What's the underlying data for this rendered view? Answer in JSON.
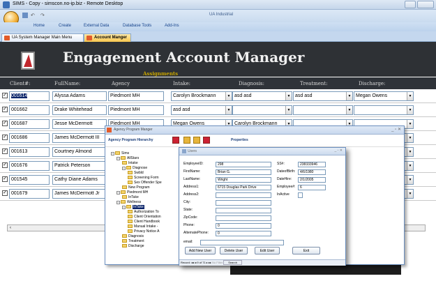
{
  "window": {
    "title": "SIMS - Copy - simscon.no-ip.biz - Remote Desktop",
    "app_title": "UA Industrial"
  },
  "ribbon": {
    "tabs": [
      "Home",
      "Create",
      "External Data",
      "Database Tools",
      "Add-Ins"
    ]
  },
  "doc_tabs": [
    "UA System Manager Main Menu",
    "Account Manger"
  ],
  "header": {
    "title": "Engagement Account Manager",
    "subtitle": "Assignments"
  },
  "columns": [
    "Client#:",
    "FullName:",
    "Agency",
    "Intake:",
    "Diagnosis:",
    "Treatment:",
    "Discharge:"
  ],
  "rows": [
    {
      "checked": true,
      "client": "001614",
      "name": "Alyssa Adams",
      "agency": "Piedmont MH",
      "intake": "Carolyn Brockmann",
      "diagnosis": "asd asd",
      "treatment": "asd asd",
      "discharge": "Megan Owens"
    },
    {
      "checked": true,
      "client": "001662",
      "name": "Drake Whitehead",
      "agency": "Piedmont MH",
      "intake": "asd asd",
      "diagnosis": "",
      "treatment": "",
      "discharge": ""
    },
    {
      "checked": true,
      "client": "001687",
      "name": "Jesse McDermott",
      "agency": "Piedmont MH",
      "intake": "Megan Owens",
      "diagnosis": "Carolyn Brockmann",
      "treatment": "",
      "discharge": ""
    },
    {
      "checked": true,
      "client": "001686",
      "name": "James McDermott III",
      "agency": "",
      "intake": "",
      "diagnosis": "",
      "treatment": "",
      "discharge": ""
    },
    {
      "checked": true,
      "client": "001613",
      "name": "Courtney Almond",
      "agency": "",
      "intake": "",
      "diagnosis": "",
      "treatment": "",
      "discharge": ""
    },
    {
      "checked": true,
      "client": "001676",
      "name": "Patrick Peterson",
      "agency": "",
      "intake": "",
      "diagnosis": "",
      "treatment": "",
      "discharge": ""
    },
    {
      "checked": true,
      "client": "001545",
      "name": "Cathy Diane Adams",
      "agency": "",
      "intake": "",
      "diagnosis": "",
      "treatment": "",
      "discharge": ""
    },
    {
      "checked": true,
      "client": "001679",
      "name": "James McDermott Jr",
      "agency": "",
      "intake": "",
      "diagnosis": "",
      "treatment": "",
      "discharge": ""
    }
  ],
  "agency_manager": {
    "title": "Agency Program Manger",
    "hierarchy_label": "Agency Program Hierarchy",
    "properties_label": "Properties",
    "tree": [
      "Sims",
      "AllStars",
      "Intake",
      "Diagnose",
      "Swbld",
      "Screening Form",
      "Sex Offender Spe",
      "New Program",
      "Piedmont MH",
      "InTake",
      "Wellness",
      "InTake",
      "Authorization To",
      "Client Orientation",
      "Client Handbook",
      "Manual Intake -",
      "Privacy Notice A",
      "Diagnosis",
      "Treatment",
      "Discharge"
    ]
  },
  "users_form": {
    "title": "Users",
    "fields": {
      "employee_id_label": "EmployeeID:",
      "employee_id": "298",
      "first_name_label": "FirstName:",
      "first_name": "Brian G.",
      "last_name_label": "LastName:",
      "last_name": "Wright",
      "address1_label": "Address1:",
      "address1": "6715 Douglas Park Drive",
      "address2_label": "Address2:",
      "address2": "",
      "city_label": "City:",
      "city": "",
      "state_label": "State:",
      "state": "",
      "zip_label": "ZipCode:",
      "zip": "",
      "phone_label": "Phone:",
      "phone": "0",
      "alt_phone_label": "AlternatePhone:",
      "alt_phone": "0",
      "email_label": "email:",
      "email": "",
      "ssn_label": "SS#:",
      "ssn": "238333946",
      "dob_label": "DateofBirth:",
      "dob": "4/6/1980",
      "hire_label": "DateHire:",
      "hire": "2/1/2005",
      "emp_num_label": "Employee#:",
      "emp_num": "6",
      "inactive_label": "InActive"
    },
    "buttons": {
      "add": "Add New User",
      "delete": "Delete User",
      "edit": "Edit User",
      "exit": "Exit"
    },
    "nav": {
      "record_label": "Record:",
      "position": "9 of 71",
      "filter": "No Filter",
      "search": "Search"
    }
  }
}
